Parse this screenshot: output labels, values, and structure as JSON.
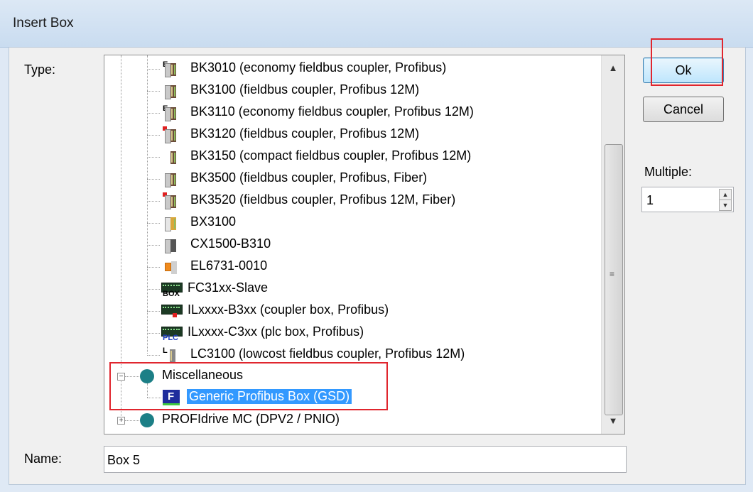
{
  "window": {
    "title": "Insert Box"
  },
  "labels": {
    "type": "Type:",
    "multiple": "Multiple:",
    "name": "Name:"
  },
  "buttons": {
    "ok": "Ok",
    "cancel": "Cancel"
  },
  "multiple": {
    "value": "1"
  },
  "name_field": {
    "value": "Box 5"
  },
  "tree": {
    "items": [
      {
        "label": "BK3010 (economy fieldbus coupler, Profibus)",
        "icon": "coupler-economy-icon"
      },
      {
        "label": "BK3100 (fieldbus coupler, Profibus 12M)",
        "icon": "coupler-icon"
      },
      {
        "label": "BK3110 (economy fieldbus coupler, Profibus 12M)",
        "icon": "coupler-economy-icon"
      },
      {
        "label": "BK3120 (fieldbus coupler, Profibus 12M)",
        "icon": "coupler-red-icon"
      },
      {
        "label": "BK3150 (compact fieldbus coupler, Profibus 12M)",
        "icon": "coupler-compact-icon"
      },
      {
        "label": "BK3500 (fieldbus coupler, Profibus, Fiber)",
        "icon": "coupler-icon"
      },
      {
        "label": "BK3520 (fieldbus coupler, Profibus 12M, Fiber)",
        "icon": "coupler-red-icon"
      },
      {
        "label": "BX3100",
        "icon": "bx-controller-icon"
      },
      {
        "label": "CX1500-B310",
        "icon": "cx-module-icon"
      },
      {
        "label": "EL6731-0010",
        "icon": "el-terminal-icon"
      },
      {
        "label": "FC31xx-Slave",
        "icon": "box-card-icon",
        "sub": "BOX"
      },
      {
        "label": "ILxxxx-B3xx (coupler box, Profibus)",
        "icon": "coupler-box-icon"
      },
      {
        "label": "ILxxxx-C3xx (plc box, Profibus)",
        "icon": "plc-box-icon",
        "sub": "PLC"
      },
      {
        "label": "LC3100 (lowcost fieldbus coupler, Profibus 12M)",
        "icon": "lowcost-coupler-icon"
      }
    ],
    "groups": [
      {
        "label": "Miscellaneous",
        "expanded": true,
        "expander": "−"
      },
      {
        "label": "PROFIdrive MC (DPV2 / PNIO)",
        "expanded": false,
        "expander": "+"
      }
    ],
    "selected_item": {
      "label": "Generic Profibus Box (GSD)",
      "icon_letter": "F"
    }
  },
  "colors": {
    "highlight": "#e0262e",
    "selection": "#3399ff",
    "group_dot": "#1c7f86"
  }
}
